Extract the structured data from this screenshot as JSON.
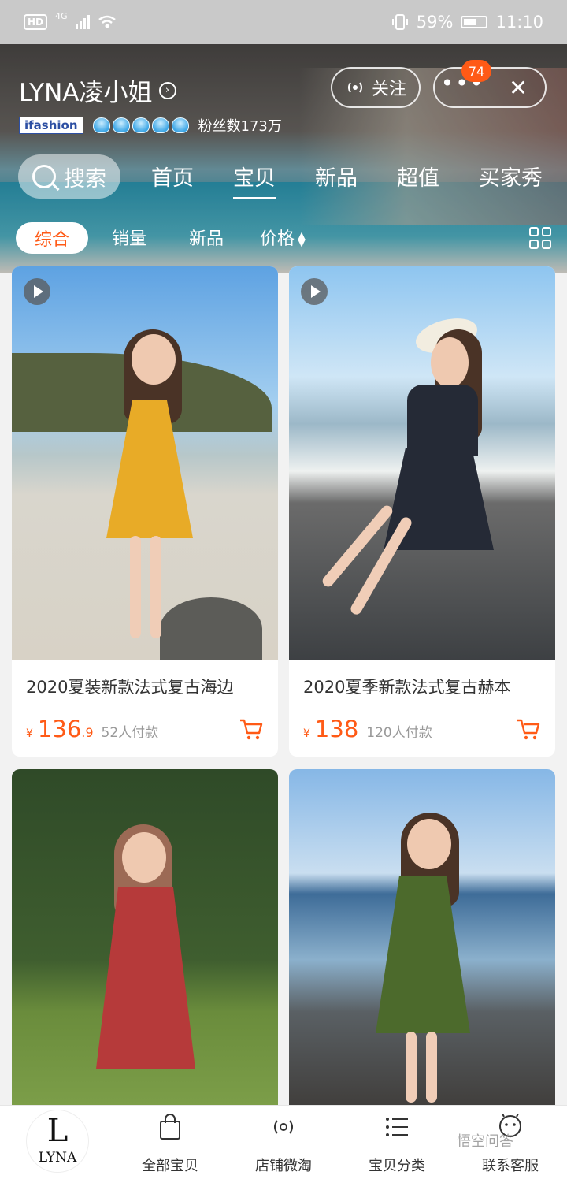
{
  "status_bar": {
    "hd": "HD",
    "signal": "4G",
    "battery": "59%",
    "time": "11:10"
  },
  "shop": {
    "name": "LYNA凌小姐",
    "badge": "ifashion",
    "fans": "粉丝数173万",
    "follow_label": "关注",
    "notification_count": "74",
    "more_icon": "more-dots-icon",
    "close_icon": "close-icon"
  },
  "nav": {
    "search_label": "搜索",
    "tabs": [
      "首页",
      "宝贝",
      "新品",
      "超值",
      "买家秀"
    ],
    "active_tab": "宝贝"
  },
  "sort": {
    "items": [
      "综合",
      "销量",
      "新品",
      "价格"
    ],
    "active": "综合"
  },
  "products": [
    {
      "title": "2020夏装新款法式复古海边",
      "currency": "¥",
      "price": "136",
      "price_decimal": ".9",
      "sold": "52人付款"
    },
    {
      "title": "2020夏季新款法式复古赫本",
      "currency": "¥",
      "price": "138",
      "price_decimal": "",
      "sold": "120人付款"
    },
    {
      "title": "",
      "currency": "",
      "price": "",
      "price_decimal": "",
      "sold": ""
    },
    {
      "title": "",
      "currency": "",
      "price": "",
      "price_decimal": "",
      "sold": ""
    }
  ],
  "bottom_bar": {
    "logo_letter": "L",
    "logo_text": "LYNA",
    "items": [
      "全部宝贝",
      "店铺微淘",
      "宝贝分类",
      "联系客服"
    ]
  },
  "watermark": "悟空问答",
  "colors": {
    "accent": "#ff5a16",
    "status_bar": "#c9c9c9"
  }
}
